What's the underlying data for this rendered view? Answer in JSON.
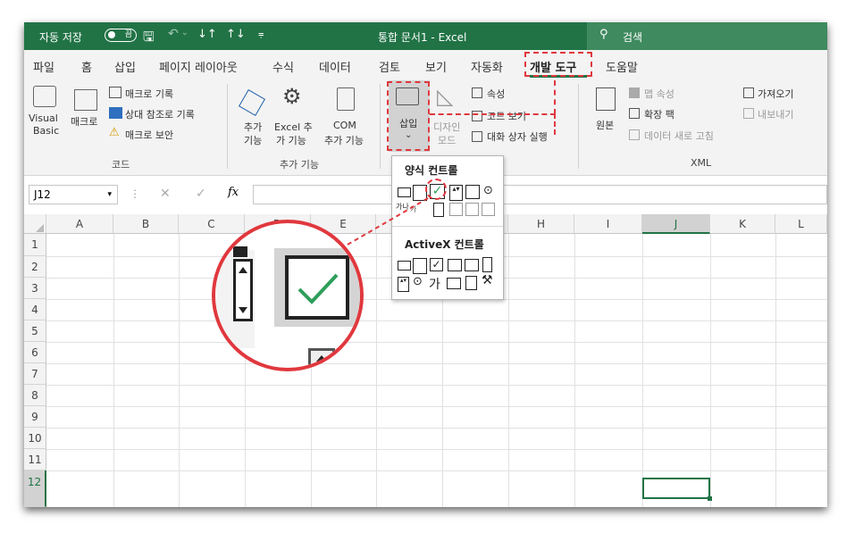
{
  "titlebar": {
    "autosave_label": "자동 저장",
    "autosave_state": "끔",
    "document_title": "통합 문서1 - Excel",
    "search_placeholder": "검색"
  },
  "menu": [
    "파일",
    "홈",
    "삽입",
    "페이지 레이아웃",
    "수식",
    "데이터",
    "검토",
    "보기",
    "자동화",
    "개발 도구",
    "도움말"
  ],
  "active_tab": "개발 도구",
  "ribbon": {
    "code": {
      "visual_basic_1": "Visual",
      "visual_basic_2": "Basic",
      "macro": "매크로",
      "record_macro": "매크로 기록",
      "relative_ref": "상대 참조로 기록",
      "macro_security": "매크로 보안",
      "group_label": "코드"
    },
    "addins": {
      "addins_1": "추가",
      "addins_2": "기능",
      "excel_addins_1": "Excel 추",
      "excel_addins_2": "가 기능",
      "com_addins_1": "COM",
      "com_addins_2": "추가 기능",
      "group_label": "추가 기능"
    },
    "controls": {
      "insert": "삽입",
      "design_mode_1": "디자인",
      "design_mode_2": "모드",
      "properties": "속성",
      "view_code": "코드 보기",
      "run_dialog": "대화 상자 실행"
    },
    "xml": {
      "source": "원본",
      "map_properties": "맵 속성",
      "expansion_packs": "확장 팩",
      "refresh_data": "데이터 새로 고침",
      "import": "가져오기",
      "export": "내보내기",
      "group_label": "XML"
    }
  },
  "formula_bar": {
    "name_box": "J12",
    "fx": "fx"
  },
  "sheet": {
    "columns": [
      "A",
      "B",
      "C",
      "D",
      "E",
      "F",
      "G",
      "H",
      "I",
      "J",
      "K",
      "L"
    ],
    "rows": [
      "1",
      "2",
      "3",
      "4",
      "5",
      "6",
      "7",
      "8",
      "9",
      "10",
      "11",
      "12"
    ],
    "selected_cell": "J12"
  },
  "dropdown": {
    "form_controls_title": "양식 컨트롤",
    "activex_title": "ActiveX 컨트롤",
    "label_glyph": "가",
    "caption_small": "가나"
  },
  "colors": {
    "excel_green": "#217346",
    "highlight_red": "#e0383e",
    "check_green": "#2e9e5a"
  }
}
